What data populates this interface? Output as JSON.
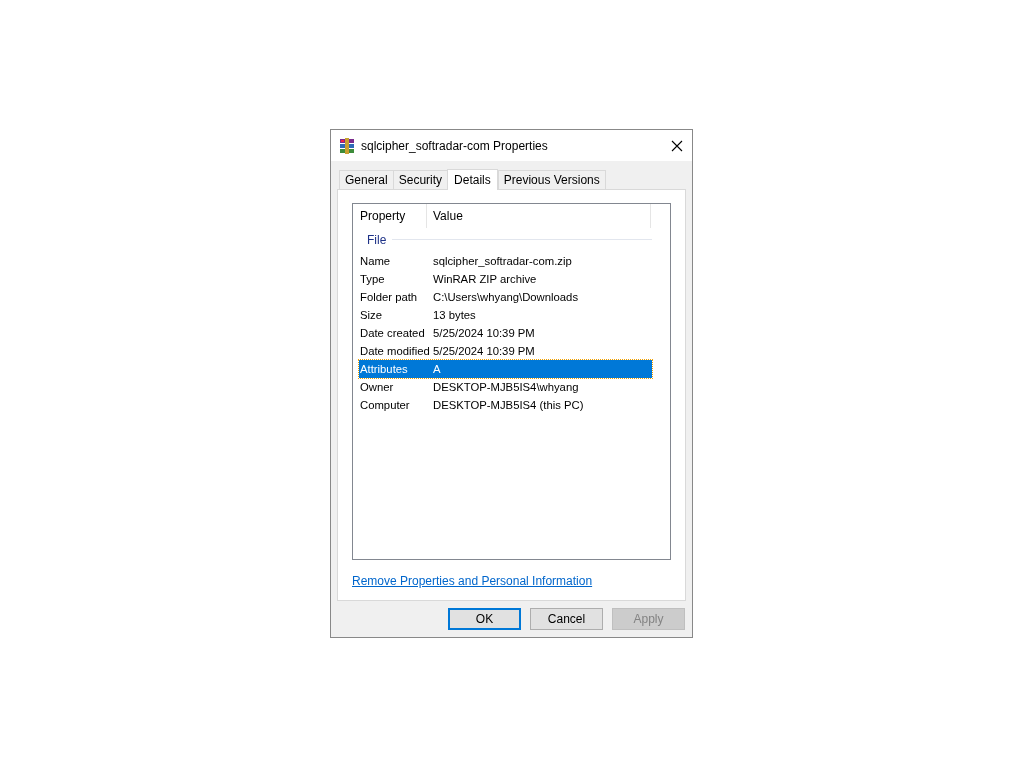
{
  "window": {
    "title": "sqlcipher_softradar-com Properties"
  },
  "tabs": [
    {
      "label": "General",
      "selected": false
    },
    {
      "label": "Security",
      "selected": false
    },
    {
      "label": "Details",
      "selected": true
    },
    {
      "label": "Previous Versions",
      "selected": false
    }
  ],
  "table": {
    "columns": [
      "Property",
      "Value"
    ],
    "group": "File",
    "rows": [
      {
        "property": "Name",
        "value": "sqlcipher_softradar-com.zip",
        "selected": false
      },
      {
        "property": "Type",
        "value": "WinRAR ZIP archive",
        "selected": false
      },
      {
        "property": "Folder path",
        "value": "C:\\Users\\whyang\\Downloads",
        "selected": false
      },
      {
        "property": "Size",
        "value": "13 bytes",
        "selected": false
      },
      {
        "property": "Date created",
        "value": "5/25/2024 10:39 PM",
        "selected": false
      },
      {
        "property": "Date modified",
        "value": "5/25/2024 10:39 PM",
        "selected": false
      },
      {
        "property": "Attributes",
        "value": "A",
        "selected": true
      },
      {
        "property": "Owner",
        "value": "DESKTOP-MJB5IS4\\whyang",
        "selected": false
      },
      {
        "property": "Computer",
        "value": "DESKTOP-MJB5IS4 (this PC)",
        "selected": false
      }
    ]
  },
  "link": "Remove Properties and Personal Information",
  "buttons": [
    {
      "label": "OK",
      "default": true,
      "disabled": false
    },
    {
      "label": "Cancel",
      "default": false,
      "disabled": false
    },
    {
      "label": "Apply",
      "default": false,
      "disabled": true
    }
  ]
}
